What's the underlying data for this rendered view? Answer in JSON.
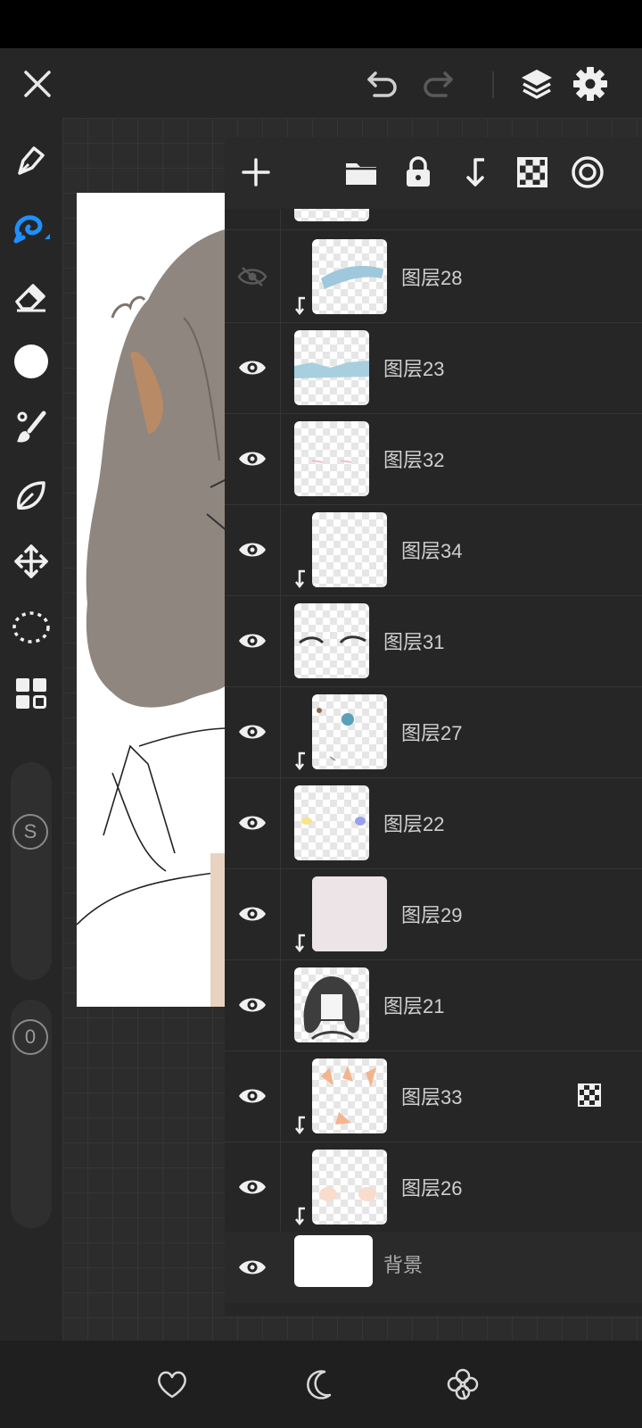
{
  "layers": [
    {
      "name": "图层28",
      "visible": false,
      "clipped": true
    },
    {
      "name": "图层23",
      "visible": true,
      "clipped": false
    },
    {
      "name": "图层32",
      "visible": true,
      "clipped": false
    },
    {
      "name": "图层34",
      "visible": true,
      "clipped": true
    },
    {
      "name": "图层31",
      "visible": true,
      "clipped": false
    },
    {
      "name": "图层27",
      "visible": true,
      "clipped": true
    },
    {
      "name": "图层22",
      "visible": true,
      "clipped": false
    },
    {
      "name": "图层29",
      "visible": true,
      "clipped": true
    },
    {
      "name": "图层21",
      "visible": true,
      "clipped": false
    },
    {
      "name": "图层33",
      "visible": true,
      "clipped": true,
      "alpha_lock": true
    },
    {
      "name": "图层26",
      "visible": true,
      "clipped": true
    },
    {
      "name": "背景",
      "visible": true,
      "clipped": false
    }
  ],
  "sliders": {
    "size_label": "S",
    "opacity_label": "0"
  },
  "colors": {
    "accent": "#1e90ff",
    "panel": "#262626",
    "toolbar": "#262626",
    "status_bar": "#000000"
  },
  "icons": {
    "top": [
      "close-icon",
      "undo-icon",
      "redo-icon",
      "layers-icon",
      "settings-icon"
    ],
    "left": [
      "pen-icon",
      "brush-icon",
      "eraser-icon",
      "color-icon",
      "paint-icon",
      "leaf-icon",
      "move-icon",
      "lasso-icon",
      "grid-icon"
    ],
    "panel": [
      "add-layer-icon",
      "folder-icon",
      "lock-icon",
      "merge-down-icon",
      "alpha-lock-icon",
      "blend-mode-icon"
    ],
    "bottom": [
      "heart-icon",
      "moon-icon",
      "clover-icon"
    ]
  }
}
